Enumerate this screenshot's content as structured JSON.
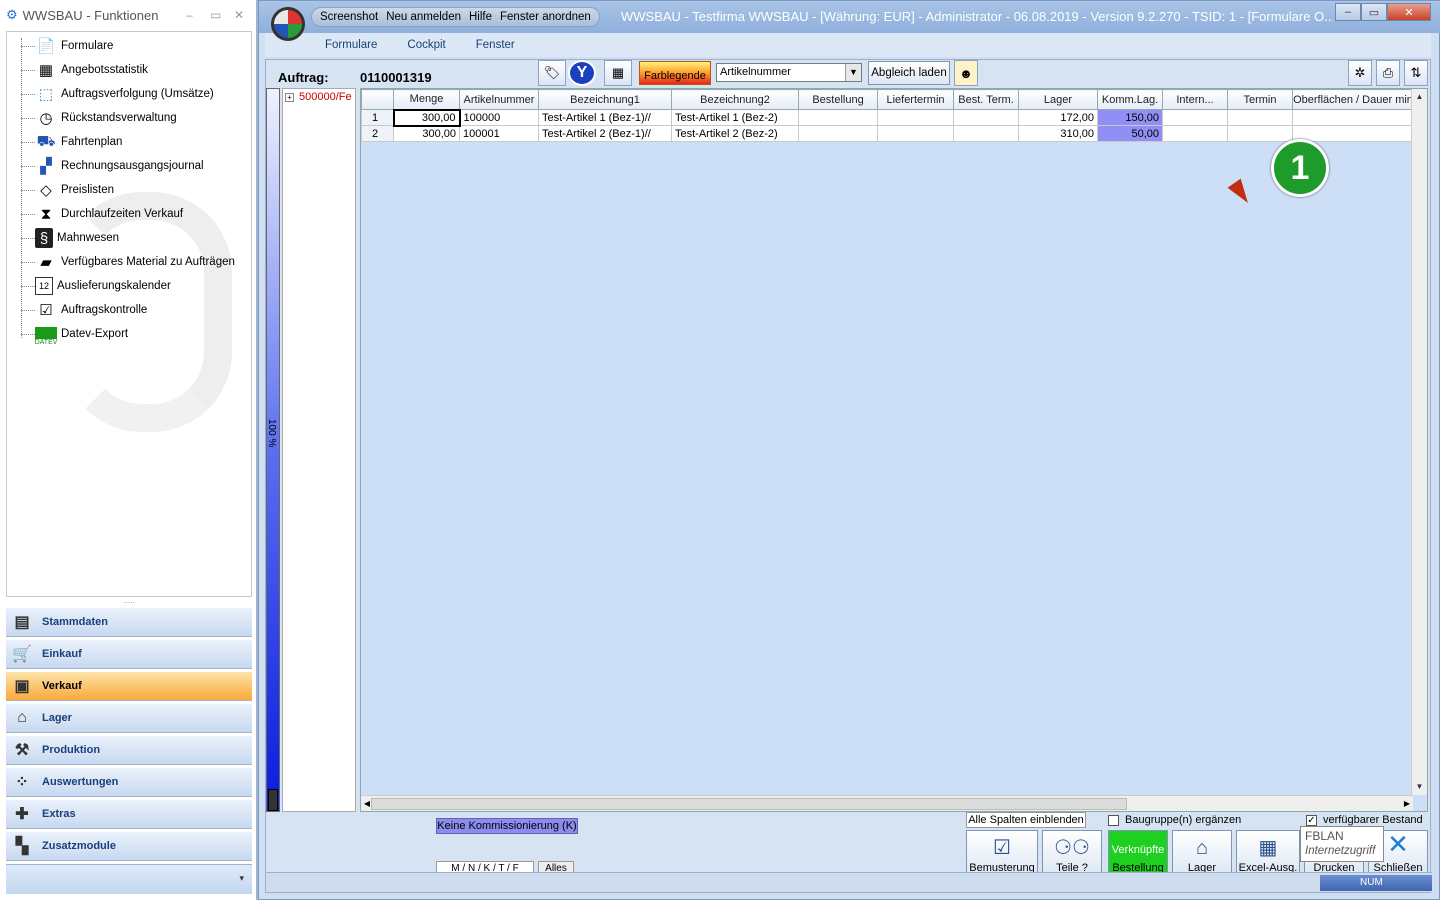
{
  "left_panel": {
    "title": "WWSBAU - Funktionen",
    "controls": [
      "–",
      "▭",
      "✕"
    ],
    "tree_items": [
      {
        "label": "Formulare",
        "icon": "document-icon"
      },
      {
        "label": "Angebotsstatistik",
        "icon": "spreadsheet-icon"
      },
      {
        "label": "Auftragsverfolgung (Umsätze)",
        "icon": "tracking-icon"
      },
      {
        "label": "Rückstandsverwaltung",
        "icon": "backlog-clock-icon"
      },
      {
        "label": "Fahrtenplan",
        "icon": "truck-icon"
      },
      {
        "label": "Rechnungsausgangsjournal",
        "icon": "journal-icon"
      },
      {
        "label": "Preislisten",
        "icon": "price-tag-icon"
      },
      {
        "label": "Durchlaufzeiten Verkauf",
        "icon": "hourglass-icon"
      },
      {
        "label": "Mahnwesen",
        "icon": "dunning-icon"
      },
      {
        "label": "Verfügbares Material zu Aufträgen",
        "icon": "material-icon"
      },
      {
        "label": "Auslieferungskalender",
        "icon": "calendar-icon"
      },
      {
        "label": "Auftragskontrolle",
        "icon": "checklist-icon"
      },
      {
        "label": "Datev-Export",
        "icon": "datev-icon"
      }
    ],
    "datev_icon_text": "DATEV",
    "calendar_icon_text": "12",
    "splitter": ".....",
    "nav_sections": [
      {
        "label": "Stammdaten",
        "icon": "master-data-icon"
      },
      {
        "label": "Einkauf",
        "icon": "shopping-cart-icon"
      },
      {
        "label": "Verkauf",
        "icon": "cash-register-icon",
        "active": true
      },
      {
        "label": "Lager",
        "icon": "warehouse-icon"
      },
      {
        "label": "Produktion",
        "icon": "production-icon"
      },
      {
        "label": "Auswertungen",
        "icon": "analytics-icon"
      },
      {
        "label": "Extras",
        "icon": "extras-icon"
      },
      {
        "label": "Zusatzmodule",
        "icon": "modules-icon"
      }
    ],
    "nav_footer_arrow": "▾"
  },
  "window": {
    "quick_access": [
      "Screenshot",
      "Neu anmelden",
      "Hilfe",
      "Fenster anordnen"
    ],
    "title": "WWSBAU - Testfirma WWSBAU - [Währung: EUR] - Administrator - 06.08.2019 - Version 9.2.270 - TSID: 1 - [Formulare O...",
    "menu": [
      "Formulare",
      "Cockpit",
      "Fenster"
    ],
    "controls": [
      "–",
      "▭",
      "✕"
    ]
  },
  "form": {
    "auftrag_label": "Auftrag:",
    "auftrag_value": "0110001319",
    "farblegende_label": "Farblegende",
    "combo_value": "Artikelnummer",
    "abgleich_label": "Abgleich laden",
    "level_label": "100 %",
    "tree_node": "500000/Fe",
    "tree_node_toggle": "+"
  },
  "grid": {
    "columns": [
      "",
      "Menge",
      "Artikelnummer",
      "Bezeichnung1",
      "Bezeichnung2",
      "Bestellung",
      "Liefertermin",
      "Best. Term.",
      "Lager",
      "Komm.Lag.",
      "Intern...",
      "Termin",
      "Oberflächen / Dauer min"
    ],
    "rows": [
      {
        "nr": "1",
        "menge": "300,00",
        "artikelnummer": "100000",
        "bez1": "Test-Artikel 1  (Bez-1)//",
        "bez2": "Test-Artikel 1  (Bez-2)",
        "bestellung": "",
        "liefertermin": "",
        "best_term": "",
        "lager": "172,00",
        "komm_lag": "150,00",
        "intern": "",
        "termin": "",
        "oberflaechen": ""
      },
      {
        "nr": "2",
        "menge": "300,00",
        "artikelnummer": "100001",
        "bez1": "Test-Artikel 2  (Bez-1)//",
        "bez2": "Test-Artikel 2  (Bez-2)",
        "bestellung": "",
        "liefertermin": "",
        "best_term": "",
        "lager": "310,00",
        "komm_lag": "50,00",
        "intern": "",
        "termin": "",
        "oberflaechen": ""
      }
    ]
  },
  "annotation": {
    "badge": "1"
  },
  "bottom": {
    "keine_kommissionierung": "Keine Kommissionierung (K)",
    "filter_mnktf": "M / N / K / T / F",
    "filter_alles": "Alles",
    "alle_spalten": "Alle Spalten einblenden",
    "baugruppe_label": "Baugruppe(n) ergänzen",
    "baugruppe_checked": false,
    "verfuegbar_label": "verfügbarer Bestand",
    "verfuegbar_checked": true,
    "check_mark": "✓",
    "buttons": [
      {
        "label": "Bemusterung",
        "icon": "checklist-icon"
      },
      {
        "label": "Teile ?",
        "icon": "binoculars-icon"
      },
      {
        "label": "Verknüpfte",
        "label2": "Bestellung",
        "icon": ""
      },
      {
        "label": "Lager",
        "icon": "warehouse-icon"
      },
      {
        "label": "Excel-Ausg.",
        "icon": "excel-icon"
      },
      {
        "label": "Drucken",
        "icon": "printer-icon"
      },
      {
        "label": "Schließen",
        "icon": "close-icon"
      }
    ],
    "fblan_title": "FBLAN",
    "fblan_sub": "Internetzugriff",
    "status_num": "NUM"
  },
  "colors": {
    "accent_active_nav": "#f9a93c",
    "komm_cell": "#8f8ff5",
    "badge": "#1e9b2b",
    "verknuepfte": "#20d020"
  }
}
